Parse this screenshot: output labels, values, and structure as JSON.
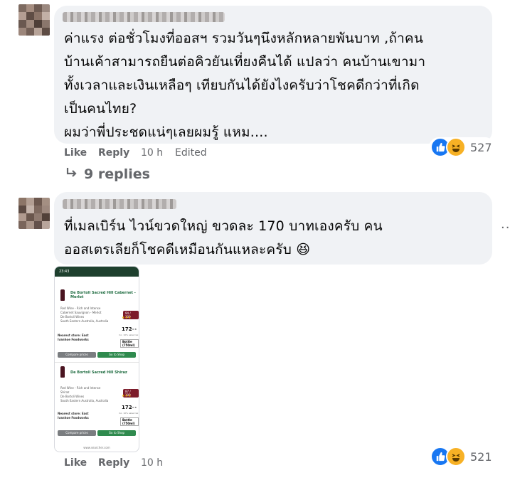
{
  "comment1": {
    "text": "ค่าแรง ต่อชั่วโมงที่ออสฯ รวมวันๆนึงหลักหลายพันบาท ,ถ้าคน\nบ้านเค้าสามารถยืนต่อคิวยันเที่ยงคืนได้ แปลว่า คนบ้านเขามา\nทั้งเวลาและเงินเหลือๆ เทียบกันได้ยังไงครับว่าโชคดีกว่าที่เกิด\nเป็นคนไทย?\nผมว่าพี่ประชดแน่ๆเลยผมรู้ แหม....",
    "like_label": "Like",
    "reply_label": "Reply",
    "time": "10 h",
    "edited_label": "Edited",
    "reaction_count": "527",
    "replies_label": "9 replies"
  },
  "comment2": {
    "text": "ที่เมลเบิร์น ไวน์ขวดใหญ่ ขวดละ 170 บาทเองครับ คน\nออสเตรเลียก็โชคดีเหมือนกันแหละครับ 😆",
    "like_label": "Like",
    "reply_label": "Reply",
    "time": "10 h",
    "reaction_count": "521",
    "more_label": "···"
  },
  "attachment": {
    "status_time": "23:43",
    "wines": [
      {
        "name": "De Bortoli Sacred Hill Cabernet - Merlot",
        "details": [
          "Red Wine - Rich and Intense",
          "Cabernet Sauvignon - Merlot",
          "De Bortoli Wines",
          "South Eastern Australia, Australia"
        ],
        "score": "94 / 100",
        "stars": "★★★",
        "price": "172",
        "price_small": "00 B",
        "price_note": "Inc. 10% sales tax",
        "store_label": "Nearest store: East Ivanhoe Foodworks",
        "size": "Bottle (750ml)",
        "compare_label": "Compare prices",
        "shop_label": "Go to Shop"
      },
      {
        "name": "De Bortoli Sacred Hill Shiraz",
        "details": [
          "Red Wine - Rich and Intense",
          "Shiraz",
          "De Bortoli Wines",
          "South Eastern Australia, Australia"
        ],
        "score": "87 / 100",
        "stars": "★★★",
        "price": "172",
        "price_small": "00 B",
        "price_note": "Inc. 10% sales tax",
        "store_label": "Nearest store: East Ivanhoe Foodworks",
        "size": "Bottle (750ml)",
        "compare_label": "Compare prices",
        "shop_label": "Go to Shop"
      }
    ],
    "url": "www.searcher.com"
  },
  "colors": {
    "bubble": "#f0f2f5",
    "meta_text": "#65676b",
    "like_blue": "#1877f2",
    "haha_yellow": "#f7b125",
    "wine_green": "#2f8a4e"
  },
  "icons": [
    "like-reaction-icon",
    "haha-reaction-icon",
    "reply-arrow-icon",
    "more-options-icon"
  ]
}
